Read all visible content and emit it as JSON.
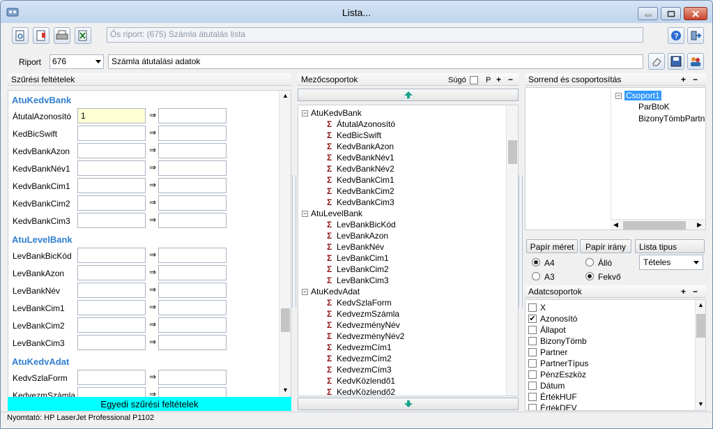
{
  "window": {
    "title": "Lista..."
  },
  "toolbar": {
    "report_path": "Ős riport: (675)  Számla átutalás lista",
    "riport_label": "Riport",
    "riport_value": "676",
    "riport_desc": "Számla átutalási adatok"
  },
  "filters": {
    "title": "Szűrési feltételek",
    "groups": [
      {
        "name": "AtuKedvBank",
        "fields": [
          {
            "label": "ÁtutalAzonosító",
            "from": "1"
          },
          {
            "label": "KedBicSwift",
            "from": ""
          },
          {
            "label": "KedvBankAzon",
            "from": ""
          },
          {
            "label": "KedvBankNév1",
            "from": ""
          },
          {
            "label": "KedvBankCim1",
            "from": ""
          },
          {
            "label": "KedvBankCim2",
            "from": ""
          },
          {
            "label": "KedvBankCim3",
            "from": ""
          }
        ]
      },
      {
        "name": "AtuLevelBank",
        "fields": [
          {
            "label": "LevBankBicKód",
            "from": ""
          },
          {
            "label": "LevBankAzon",
            "from": ""
          },
          {
            "label": "LevBankNév",
            "from": ""
          },
          {
            "label": "LevBankCim1",
            "from": ""
          },
          {
            "label": "LevBankCim2",
            "from": ""
          },
          {
            "label": "LevBankCim3",
            "from": ""
          }
        ]
      },
      {
        "name": "AtuKedvAdat",
        "fields": [
          {
            "label": "KedvSzlaForm",
            "from": ""
          },
          {
            "label": "KedvezmSzámla",
            "from": ""
          }
        ]
      }
    ],
    "custom_button": "Egyedi szűrési feltételek"
  },
  "field_groups": {
    "title": "Mezőcsoportok",
    "help": "Súgó",
    "p": "P",
    "tree": [
      {
        "group": "AtuKedvBank",
        "items": [
          "ÁtutalAzonosító",
          "KedBicSwift",
          "KedvBankAzon",
          "KedvBankNév1",
          "KedvBankNév2",
          "KedvBankCim1",
          "KedvBankCim2",
          "KedvBankCim3"
        ]
      },
      {
        "group": "AtuLevelBank",
        "items": [
          "LevBankBicKód",
          "LevBankAzon",
          "LevBankNév",
          "LevBankCim1",
          "LevBankCim2",
          "LevBankCim3"
        ]
      },
      {
        "group": "AtuKedvAdat",
        "items": [
          "KedvSzlaForm",
          "KedvezmSzámla",
          "KedvezményNév",
          "KedvezményNév2",
          "KedvezmCím1",
          "KedvezmCím2",
          "KedvezmCím3",
          "KedvKözlendő1",
          "KedvKözlendő2"
        ]
      }
    ]
  },
  "sorting": {
    "title": "Sorrend és csoportosítás",
    "group_node": "Csoport1",
    "children": [
      "ParBtoK",
      "BizonyTömbPartn"
    ]
  },
  "paper": {
    "size_tab": "Papír méret",
    "orient_tab": "Papír irány",
    "list_type_tab": "Lista tipus",
    "sizes": [
      {
        "label": "A4",
        "selected": true
      },
      {
        "label": "A3",
        "selected": false
      }
    ],
    "orientations": [
      {
        "label": "Álló",
        "selected": false
      },
      {
        "label": "Fekvő",
        "selected": true
      }
    ],
    "list_type": "Tételes"
  },
  "data_groups": {
    "title": "Adatcsoportok",
    "items": [
      {
        "label": "X",
        "checked": false
      },
      {
        "label": "Azonosító",
        "checked": true
      },
      {
        "label": "Állapot",
        "checked": false
      },
      {
        "label": "BizonyTömb",
        "checked": false
      },
      {
        "label": "Partner",
        "checked": false
      },
      {
        "label": "PartnerTípus",
        "checked": false
      },
      {
        "label": "PénzEszköz",
        "checked": false
      },
      {
        "label": "Dátum",
        "checked": false
      },
      {
        "label": "ÉrtékHUF",
        "checked": false
      },
      {
        "label": "ÉrtékDEV",
        "checked": false
      }
    ]
  },
  "status": {
    "printer": "Nyomtató: HP LaserJet Professional P1102"
  },
  "colors": {
    "accent": "#2f7fcf",
    "custom_filter_bg": "#00ffff",
    "selected_node": "#3399ff"
  }
}
